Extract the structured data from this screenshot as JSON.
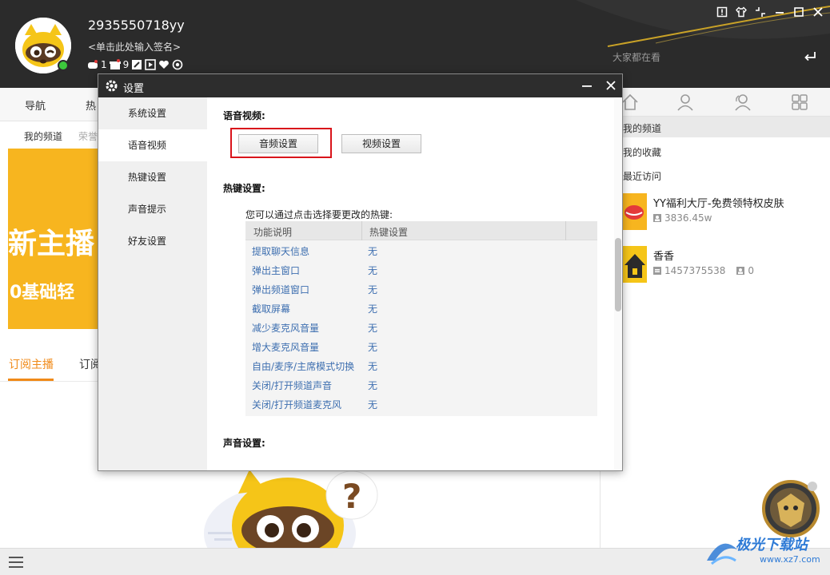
{
  "header": {
    "username": "2935550718yy",
    "signature": "<单击此处输入签名>",
    "badges": [
      {
        "icon": "gamepad-icon",
        "count": "1"
      },
      {
        "icon": "gift-icon",
        "count": "9"
      },
      {
        "icon": "edit-icon",
        "count": ""
      },
      {
        "icon": "play-icon",
        "count": ""
      },
      {
        "icon": "heart-icon",
        "count": ""
      },
      {
        "icon": "eye-icon",
        "count": ""
      }
    ],
    "search_placeholder": "大家都在看"
  },
  "nav": {
    "items": [
      "导航",
      "热"
    ]
  },
  "subnav": {
    "items": [
      "我的频道",
      "荣誉"
    ]
  },
  "banner": {
    "line1": "新主播",
    "line2": "0基础轻"
  },
  "tabs": {
    "items": [
      "订阅主播",
      "订阅"
    ]
  },
  "right_panel": {
    "links": [
      "我的频道",
      "我的收藏",
      "最近访问"
    ],
    "channels": [
      {
        "name": "YY福利大厅-免费领特权皮肤",
        "viewers": "3836.45w",
        "id": "",
        "online": ""
      },
      {
        "name": "香香",
        "viewers": "",
        "id": "1457375538",
        "online": "0"
      }
    ]
  },
  "dialog": {
    "title": "设置",
    "sidebar": [
      "系统设置",
      "语音视频",
      "热键设置",
      "声音提示",
      "好友设置"
    ],
    "active_index": 1,
    "section_av": "语音视频:",
    "btn_audio": "音频设置",
    "btn_video": "视频设置",
    "section_hotkey": "热键设置:",
    "hotkey_hint": "您可以通过点击选择要更改的热键:",
    "col_function": "功能说明",
    "col_hotkey": "热键设置",
    "hotkeys": [
      {
        "func": "提取聊天信息",
        "key": "无"
      },
      {
        "func": "弹出主窗口",
        "key": "无"
      },
      {
        "func": "弹出频道窗口",
        "key": "无"
      },
      {
        "func": "截取屏幕",
        "key": "无"
      },
      {
        "func": "减少麦克风音量",
        "key": "无"
      },
      {
        "func": "增大麦克风音量",
        "key": "无"
      },
      {
        "func": "自由/麦序/主席模式切换",
        "key": "无"
      },
      {
        "func": "关闭/打开频道声音",
        "key": "无"
      },
      {
        "func": "关闭/打开频道麦克风",
        "key": "无"
      }
    ],
    "section_sound": "声音设置:"
  },
  "watermark": {
    "text": "极光下载站",
    "url": "www.xz7.com"
  },
  "colors": {
    "header_bg": "#2b2b2b",
    "accent_gold": "#c9a227",
    "tab_active": "#f08a18",
    "highlight_red": "#d9141b",
    "link_blue": "#3e6fb0"
  }
}
